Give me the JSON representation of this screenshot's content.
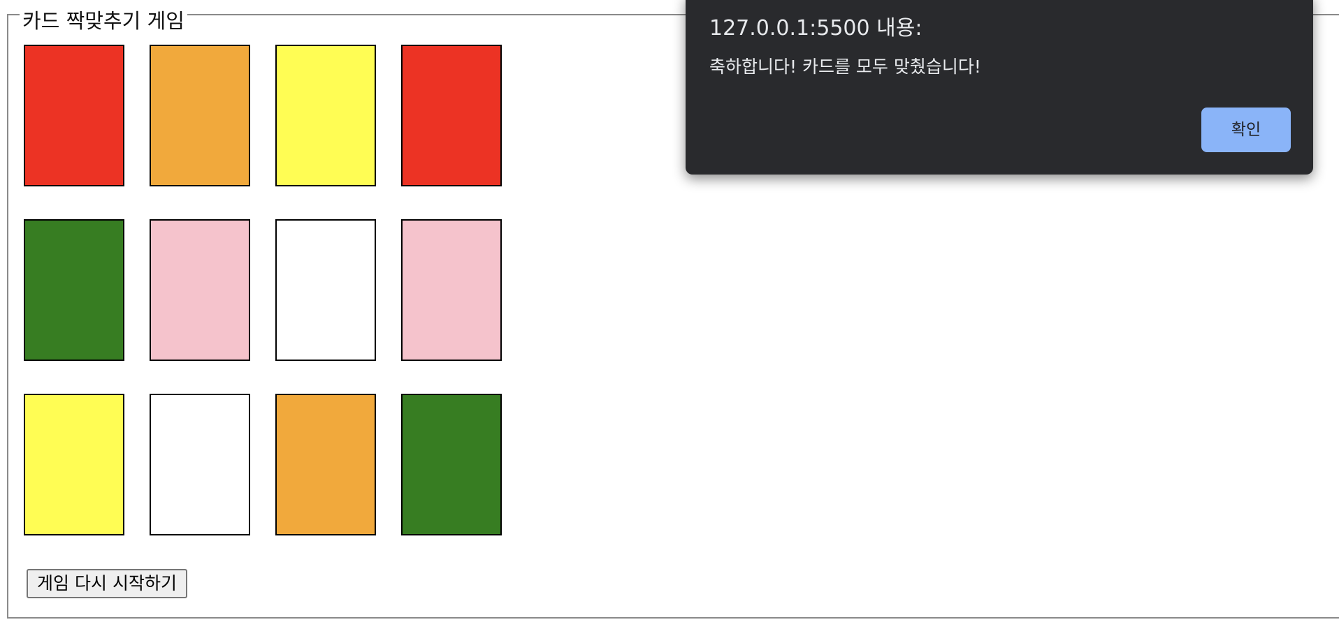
{
  "game": {
    "legend": "카드 짝맞추기 게임",
    "restart_label": "게임 다시 시작하기",
    "cards": [
      {
        "color": "#ec3324"
      },
      {
        "color": "#f1a93c"
      },
      {
        "color": "#fffd54"
      },
      {
        "color": "#ec3324"
      },
      {
        "color": "#377d22"
      },
      {
        "color": "#f5c3cc"
      },
      {
        "color": "#ffffff"
      },
      {
        "color": "#f5c3cc"
      },
      {
        "color": "#fffd54"
      },
      {
        "color": "#ffffff"
      },
      {
        "color": "#f1a93c"
      },
      {
        "color": "#377d22"
      }
    ]
  },
  "alert": {
    "origin": "127.0.0.1:5500 내용:",
    "message": "축하합니다! 카드를 모두 맞췄습니다!",
    "ok_label": "확인"
  }
}
